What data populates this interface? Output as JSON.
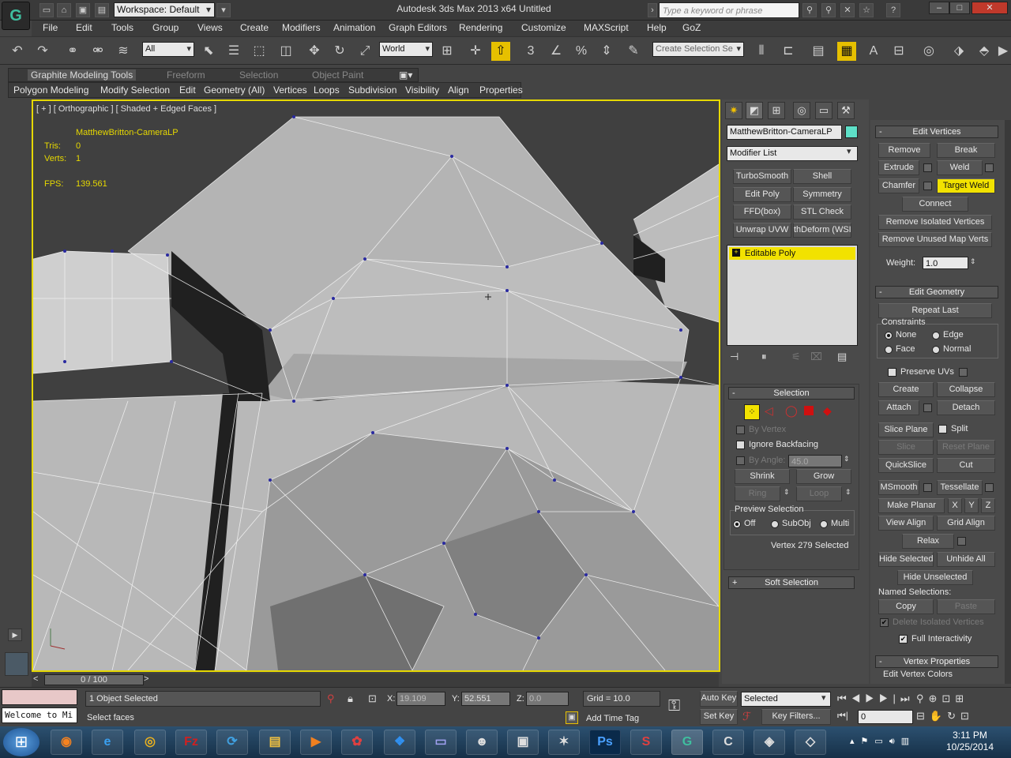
{
  "titlebar": {
    "workspace": "Workspace: Default",
    "title": "Autodesk 3ds Max  2013 x64      Untitled",
    "search_placeholder": "Type a keyword or phrase"
  },
  "menu": [
    "File",
    "Edit",
    "Tools",
    "Group",
    "Views",
    "Create",
    "Modifiers",
    "Animation",
    "Graph Editors",
    "Rendering",
    "Customize",
    "MAXScript",
    "Help",
    "GoZ"
  ],
  "toolbar": {
    "filter": "All",
    "coord": "World",
    "selection_set": "Create Selection Se"
  },
  "ribbon": {
    "tabs": [
      "Graphite Modeling Tools",
      "Freeform",
      "Selection",
      "Object Paint"
    ],
    "panels": [
      "Polygon Modeling",
      "Modify Selection",
      "Edit",
      "Geometry (All)",
      "Vertices",
      "Loops",
      "Subdivision",
      "Visibility",
      "Align",
      "Properties"
    ]
  },
  "viewport": {
    "label": "[ + ] [ Orthographic ] [ Shaded + Edged Faces ]",
    "object_name": "MatthewBritton-CameraLP",
    "tris_label": "Tris:",
    "tris": "0",
    "verts_label": "Verts:",
    "verts": "1",
    "fps_label": "FPS:",
    "fps": "139.561"
  },
  "timeline": {
    "frame": "0 / 100"
  },
  "command_panel": {
    "object_name": "MatthewBritton-CameraLP",
    "modifier_list": "Modifier List",
    "modifier_buttons": [
      "TurboSmooth",
      "Shell",
      "Edit Poly",
      "Symmetry",
      "FFD(box)",
      "STL Check",
      "Unwrap UVW",
      "thDeform (WSI"
    ],
    "stack_item": "Editable Poly",
    "selection": {
      "title": "Selection",
      "by_vertex": "By Vertex",
      "ignore_backfacing": "Ignore Backfacing",
      "by_angle": "By Angle:",
      "angle_value": "45.0",
      "shrink": "Shrink",
      "grow": "Grow",
      "ring": "Ring",
      "loop": "Loop",
      "preview_label": "Preview Selection",
      "preview_options": [
        "Off",
        "SubObj",
        "Multi"
      ],
      "status": "Vertex 279 Selected"
    },
    "soft_selection": "Soft Selection"
  },
  "edit_vertices": {
    "title": "Edit Vertices",
    "remove": "Remove",
    "break": "Break",
    "extrude": "Extrude",
    "weld": "Weld",
    "chamfer": "Chamfer",
    "target_weld": "Target Weld",
    "connect": "Connect",
    "remove_isolated": "Remove Isolated Vertices",
    "remove_unused": "Remove Unused Map Verts",
    "weight_label": "Weight:",
    "weight_value": "1.0"
  },
  "edit_geometry": {
    "title": "Edit Geometry",
    "repeat_last": "Repeat Last",
    "constraints_label": "Constraints",
    "constraints": [
      "None",
      "Edge",
      "Face",
      "Normal"
    ],
    "preserve_uvs": "Preserve UVs",
    "create": "Create",
    "collapse": "Collapse",
    "attach": "Attach",
    "detach": "Detach",
    "slice_plane": "Slice Plane",
    "split": "Split",
    "slice": "Slice",
    "reset_plane": "Reset Plane",
    "quickslice": "QuickSlice",
    "cut": "Cut",
    "msmooth": "MSmooth",
    "tessellate": "Tessellate",
    "make_planar": "Make Planar",
    "x": "X",
    "y": "Y",
    "z": "Z",
    "view_align": "View Align",
    "grid_align": "Grid Align",
    "relax": "Relax",
    "hide_selected": "Hide Selected",
    "unhide_all": "Unhide All",
    "hide_unselected": "Hide Unselected",
    "named_selections": "Named Selections:",
    "copy": "Copy",
    "paste": "Paste",
    "delete_isolated": "Delete Isolated Vertices",
    "full_interactivity": "Full Interactivity"
  },
  "vertex_properties": {
    "title": "Vertex Properties",
    "edit_colors": "Edit Vertex Colors"
  },
  "status": {
    "listener": "Welcome to Mi",
    "objects": "1 Object Selected",
    "prompt": "Select faces",
    "x_label": "X:",
    "x": "19.109",
    "y_label": "Y:",
    "y": "52.551",
    "z_label": "Z:",
    "z": "0.0",
    "grid": "Grid = 10.0",
    "add_time_tag": "Add Time Tag",
    "auto_key": "Auto Key",
    "selected": "Selected",
    "set_key": "Set Key",
    "key_filters": "Key Filters...",
    "frame": "0"
  },
  "clock": {
    "time": "3:11 PM",
    "date": "10/25/2014"
  }
}
